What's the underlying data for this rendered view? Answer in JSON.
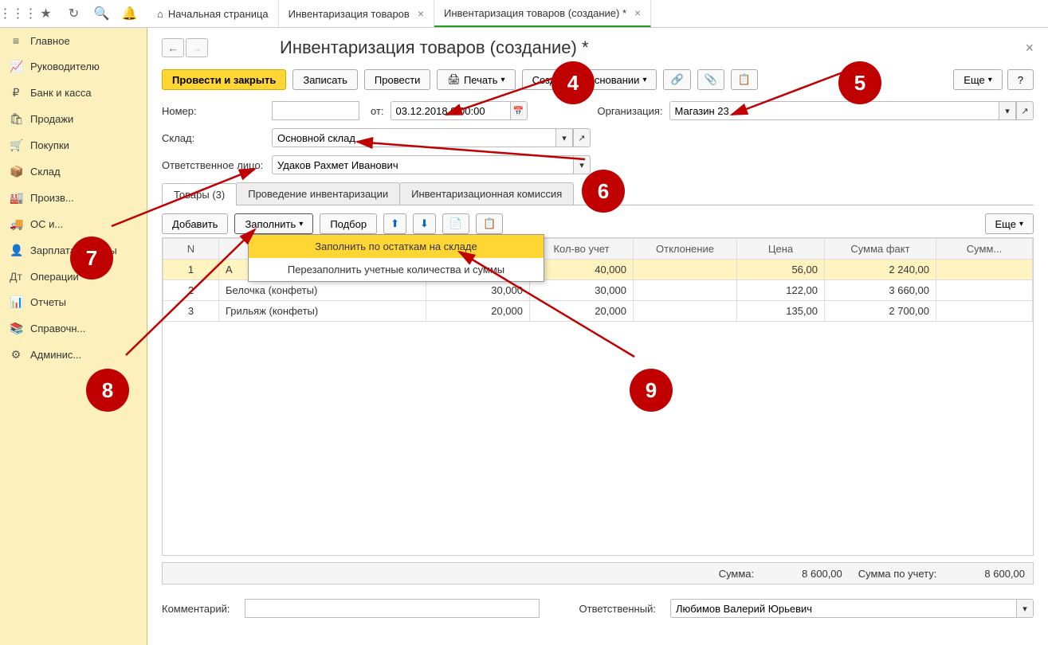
{
  "tabs": [
    {
      "label": "Начальная страница",
      "icon": "⌂"
    },
    {
      "label": "Инвентаризация товаров",
      "close": true
    },
    {
      "label": "Инвентаризация товаров (создание) *",
      "close": true,
      "active": true
    }
  ],
  "sidebar": [
    {
      "icon": "≡",
      "label": "Главное"
    },
    {
      "icon": "📈",
      "label": "Руководителю"
    },
    {
      "icon": "₽",
      "label": "Банк и касса"
    },
    {
      "icon": "🛍",
      "label": "Продажи"
    },
    {
      "icon": "🛒",
      "label": "Покупки"
    },
    {
      "icon": "📦",
      "label": "Склад"
    },
    {
      "icon": "🏭",
      "label": "Произв..."
    },
    {
      "icon": "🚚",
      "label": "ОС и..."
    },
    {
      "icon": "👤",
      "label": "Зарплата и кадры"
    },
    {
      "icon": "Дт",
      "label": "Операции"
    },
    {
      "icon": "📊",
      "label": "Отчеты"
    },
    {
      "icon": "📚",
      "label": "Справочн..."
    },
    {
      "icon": "⚙",
      "label": "Админис..."
    }
  ],
  "header": {
    "title": "Инвентаризация товаров (создание) *"
  },
  "cmd": {
    "post_close": "Провести и закрыть",
    "save": "Записать",
    "post": "Провести",
    "print": "Печать",
    "create_based": "Создать на основании",
    "more": "Еще",
    "help": "?"
  },
  "form": {
    "number_lbl": "Номер:",
    "number_val": "",
    "date_lbl": "от:",
    "date_val": "03.12.2018 0:00:00",
    "org_lbl": "Организация:",
    "org_val": "Магазин 23",
    "sklad_lbl": "Склад:",
    "sklad_val": "Основной склад",
    "resp_lbl": "Ответственное лицо:",
    "resp_val": "Удаков Рахмет Иванович"
  },
  "tabstrip": [
    {
      "label": "Товары (3)",
      "active": true
    },
    {
      "label": "Проведение инвентаризации"
    },
    {
      "label": "Инвентаризационная комиссия"
    }
  ],
  "tblbar": {
    "add": "Добавить",
    "fill": "Заполнить",
    "pick": "Подбор",
    "more": "Еще"
  },
  "dropdown": {
    "item1": "Заполнить по остаткам на складе",
    "item2": "Перезаполнить учетные количества и суммы"
  },
  "cols": [
    "N",
    "Н",
    "",
    "Кол-во учет",
    "Отклонение",
    "Цена",
    "Сумма факт",
    "Сумм..."
  ],
  "rows": [
    {
      "n": "1",
      "name": "А",
      "fact": "",
      "uchet": "40,000",
      "dev": "",
      "price": "56,00",
      "sumfact": "2 240,00",
      "hl": true
    },
    {
      "n": "2",
      "name": "Белочка (конфеты)",
      "fact": "30,000",
      "uchet": "30,000",
      "dev": "",
      "price": "122,00",
      "sumfact": "3 660,00"
    },
    {
      "n": "3",
      "name": "Грильяж (конфеты)",
      "fact": "20,000",
      "uchet": "20,000",
      "dev": "",
      "price": "135,00",
      "sumfact": "2 700,00"
    }
  ],
  "sums": {
    "sum_lbl": "Сумма:",
    "sum_val": "8 600,00",
    "uchet_lbl": "Сумма по учету:",
    "uchet_val": "8 600,00"
  },
  "footer": {
    "comment_lbl": "Комментарий:",
    "comment_val": "",
    "resp_lbl": "Ответственный:",
    "resp_val": "Любимов Валерий Юрьевич"
  },
  "annot": {
    "4": "4",
    "5": "5",
    "6": "6",
    "7": "7",
    "8": "8",
    "9": "9"
  }
}
